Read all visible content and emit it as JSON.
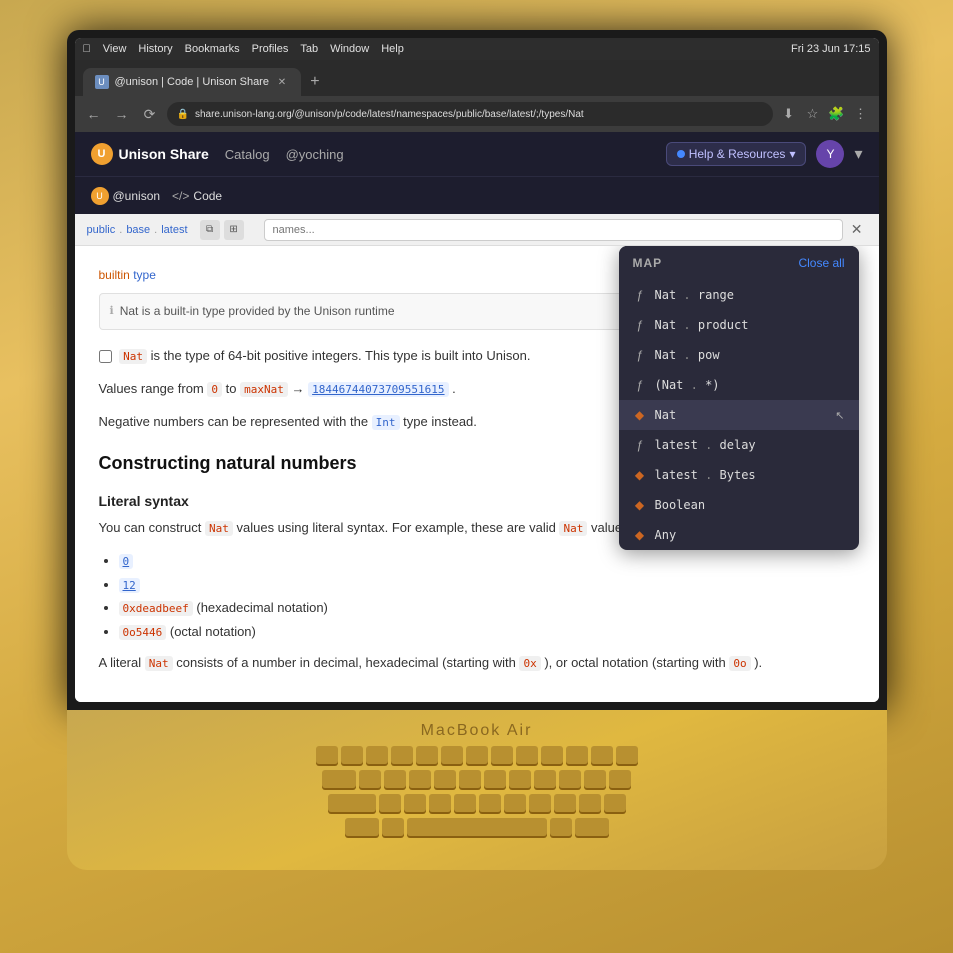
{
  "macos": {
    "menubar": {
      "items": [
        "View",
        "History",
        "Bookmarks",
        "Profiles",
        "Tab",
        "Window",
        "Help"
      ],
      "time": "Fri 23 Jun  17:15"
    }
  },
  "browser": {
    "tab": {
      "title": "@unison | Code | Unison Share",
      "favicon": "U"
    },
    "address": "share.unison-lang.org/@unison/p/code/latest/namespaces/public/base/latest/;/types/Nat"
  },
  "app": {
    "logo": "U",
    "name": "Unison Share",
    "nav": [
      "Catalog",
      "@yoching"
    ],
    "help_resources": "Help & Resources",
    "user_initial": "Y"
  },
  "secondary_nav": {
    "namespace": "@unison",
    "section": "Code"
  },
  "breadcrumb": {
    "parts": [
      "public",
      "base",
      "latest"
    ],
    "search_placeholder": "names..."
  },
  "doc": {
    "builtin_label": "builtin type",
    "info_text": "Nat is a built-in type provided by the Unison runtime",
    "para1_parts": {
      "before": "",
      "nat": "Nat",
      "mid": "is the type of 64-bit positive integers. This type is built into Unison.",
      "values_prefix": "Values range from",
      "zero": "0",
      "to": "to",
      "maxnat": "maxNat",
      "arrow": "→",
      "maxval": "18446744073709551615",
      "dot": "."
    },
    "para2": "Negative numbers can be represented with the",
    "int_type": "Int",
    "para2_end": "type instead.",
    "section_title": "Constructing natural numbers",
    "sub_title": "Literal syntax",
    "literal_desc_before": "You can construct",
    "literal_desc_nat": "Nat",
    "literal_desc_after": "values using literal syntax. For example, these are valid",
    "literal_desc_nat2": "Nat",
    "literal_desc_end": "values:",
    "bullets": [
      "0",
      "12",
      "0xdeadbeef  (hexadecimal notation)",
      "0o5446  (octal notation)"
    ],
    "para3_before": "A literal",
    "para3_nat": "Nat",
    "para3_mid": "consists of a number in decimal, hexadecimal (starting with",
    "para3_0x": "0x",
    "para3_comma": "), or octal notation (starting with",
    "para3_0o": "0o",
    "para3_end": ")."
  },
  "map": {
    "title": "MAP",
    "close_all": "Close all",
    "items": [
      {
        "icon": "ƒ",
        "icon_type": "func",
        "label": "Nat . range"
      },
      {
        "icon": "ƒ",
        "icon_type": "func",
        "label": "Nat . product"
      },
      {
        "icon": "ƒ",
        "icon_type": "func",
        "label": "Nat . pow"
      },
      {
        "icon": "ƒ",
        "icon_type": "func",
        "label": "(Nat . *)"
      },
      {
        "icon": "◆",
        "icon_type": "type",
        "label": "Nat",
        "active": true
      },
      {
        "icon": "ƒ",
        "icon_type": "func",
        "label": "latest . delay"
      },
      {
        "icon": "◆",
        "icon_type": "type",
        "label": "latest . Bytes"
      },
      {
        "icon": "◆",
        "icon_type": "type",
        "label": "Boolean"
      },
      {
        "icon": "◆",
        "icon_type": "type",
        "label": "Any"
      }
    ]
  },
  "laptop": {
    "brand": "MacBook Air"
  }
}
